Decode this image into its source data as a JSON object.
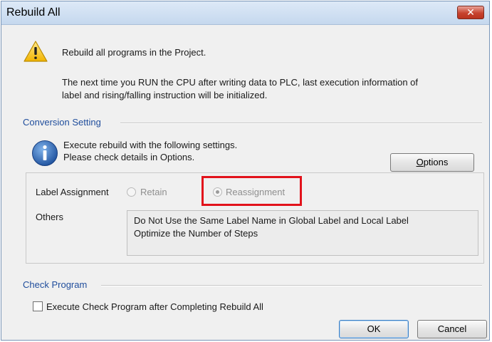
{
  "window": {
    "title": "Rebuild All",
    "close_symbol": "✕"
  },
  "message": {
    "icon": "warning-icon",
    "line1": "Rebuild all programs in the Project.",
    "line2": "The next time you RUN the CPU after writing data to PLC, last execution information of",
    "line3": "label and rising/falling instruction will be initialized."
  },
  "conversion": {
    "title": "Conversion Setting",
    "info_icon": "info-icon",
    "info_line1": "Execute rebuild with the following settings.",
    "info_line2": "Please check details in Options.",
    "options_button": "Options",
    "label_assignment": {
      "label": "Label Assignment",
      "options": [
        "Retain",
        "Reassignment"
      ],
      "selected": "Reassignment"
    },
    "others": {
      "label": "Others",
      "lines": [
        "Do Not Use the Same Label Name in Global Label and Local Label",
        "Optimize the Number of Steps"
      ]
    }
  },
  "check_program": {
    "title": "Check Program",
    "checkbox_label": "Execute Check Program after Completing Rebuild All",
    "checked": false
  },
  "buttons": {
    "ok": "OK",
    "cancel": "Cancel"
  },
  "colors": {
    "section_title": "#1f4d9c",
    "highlight": "#e2121b"
  }
}
